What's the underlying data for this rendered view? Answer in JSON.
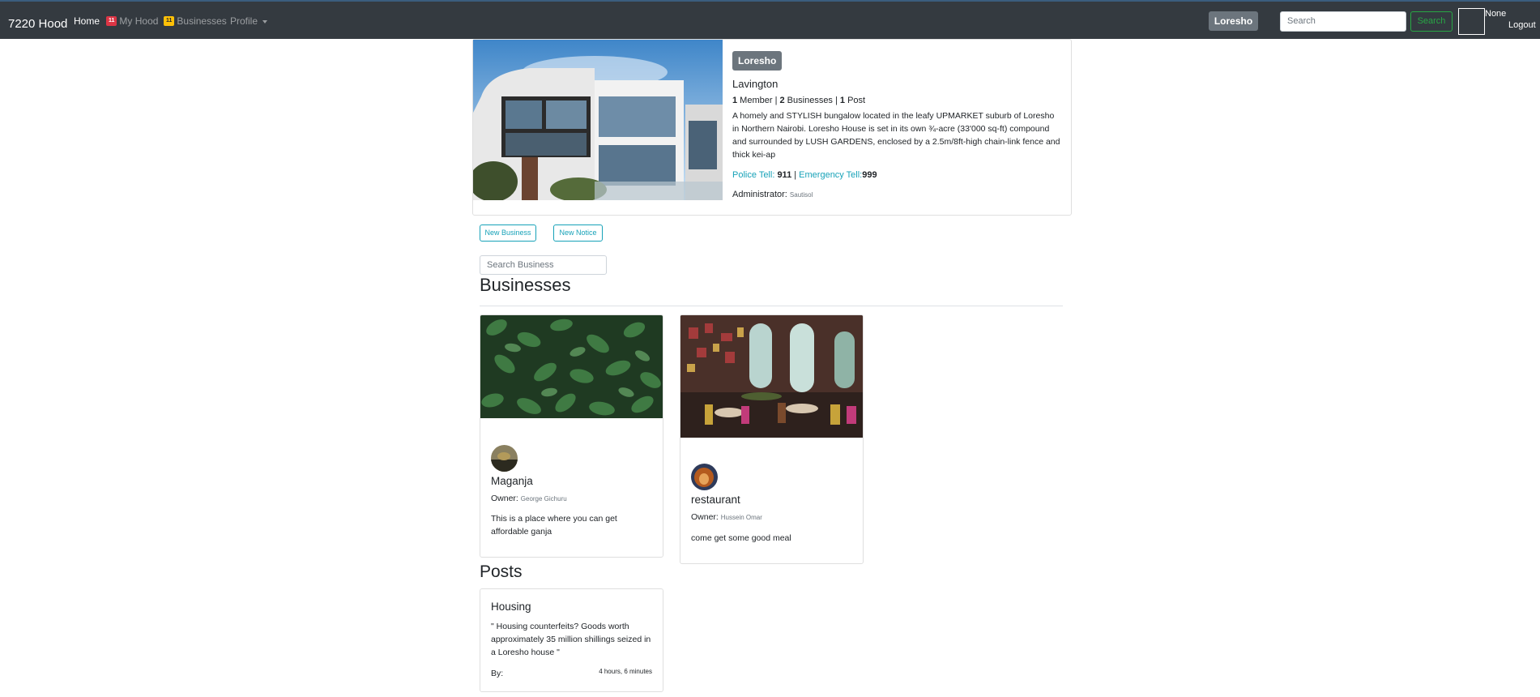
{
  "nav": {
    "brand": "7220 Hood",
    "home": "Home",
    "my_hood_badge": "11",
    "my_hood": "My Hood",
    "businesses_badge": "11",
    "businesses": "Businesses",
    "profile": "Profile",
    "hood_name": "Loresho",
    "search_placeholder": "Search",
    "search_button": "Search",
    "user_name": "None",
    "logout": "Logout"
  },
  "hood": {
    "name": "Loresho",
    "location": "Lavington",
    "member_count": "1",
    "member_label": " Member | ",
    "business_count": "2",
    "business_label": " Businesses | ",
    "post_count": "1",
    "post_label": " Post",
    "description": "A homely and STYLISH bungalow located in the leafy UPMARKET suburb of Loresho in Northern Nairobi. Loresho House is set in its own ¾-acre (33'000 sq-ft) compound and surrounded by LUSH GARDENS, enclosed by a 2.5m/8ft-high chain-link fence and thick kei-ap",
    "police_label": "Police Tell: ",
    "police_number": "911",
    "emergency_label": "Emergency Tell:",
    "emergency_number": "999",
    "admin_label": "Administrator: ",
    "admin_name": "Sautisol"
  },
  "actions": {
    "new_business": "New Business",
    "new_notice": "New Notice",
    "search_business_placeholder": "Search Business"
  },
  "businesses": {
    "title": "Businesses",
    "owner_label": "Owner: ",
    "items": [
      {
        "name": "Maganja",
        "owner": "George Gichuru",
        "description": "This is a place where you can get affordable ganja"
      },
      {
        "name": "restaurant",
        "owner": "Hussein Omar",
        "description": "come get some good meal"
      }
    ]
  },
  "posts": {
    "title": "Posts",
    "items": [
      {
        "title": "Housing",
        "quote": "\" Housing counterfeits? Goods worth approximately 35 million shillings seized in a Loresho house \"",
        "by": "By:",
        "time": "4 hours, 6 minutes"
      }
    ]
  },
  "colors": {
    "navbar": "#343a40",
    "info": "#17a2b8",
    "success": "#28a745",
    "secondary": "#6c757d"
  }
}
